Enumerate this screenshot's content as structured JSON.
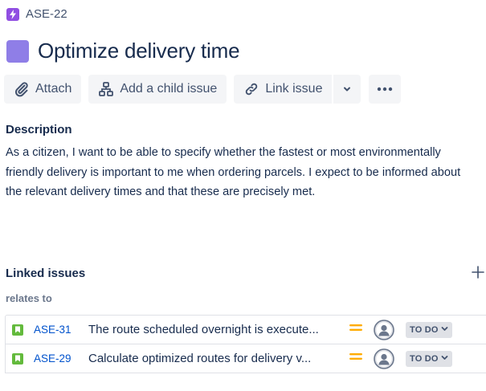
{
  "breadcrumb": {
    "issue_key": "ASE-22",
    "icon": "epic-lightning-icon"
  },
  "page_title": "Optimize delivery time",
  "toolbar": {
    "attach_label": "Attach",
    "add_child_label": "Add a child issue",
    "link_issue_label": "Link issue"
  },
  "description": {
    "label": "Description",
    "text": "As a citizen, I want to be able to specify whether the fastest or most environmentally friendly delivery is important to me when ordering parcels.  I expect to be informed about the relevant delivery times and that these are precisely met."
  },
  "linked_issues": {
    "label": "Linked issues",
    "relation": "relates to",
    "items": [
      {
        "key": "ASE-31",
        "summary": "The route scheduled overnight is execute...",
        "status": "TO DO",
        "priority": "medium"
      },
      {
        "key": "ASE-29",
        "summary": "Calculate optimized routes for delivery v...",
        "status": "TO DO",
        "priority": "medium"
      }
    ]
  },
  "colors": {
    "epic": "#904EE2",
    "title_swatch": "#8F7EE7",
    "story": "#63BA3C",
    "link": "#0052CC",
    "priority_medium": "#FFAB00"
  }
}
